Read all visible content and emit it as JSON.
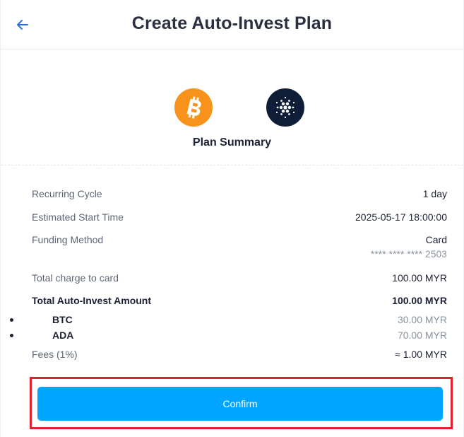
{
  "header": {
    "title": "Create Auto-Invest Plan",
    "back_icon": "arrow-left-icon"
  },
  "summary": {
    "title": "Plan Summary",
    "coins": [
      {
        "symbol": "BTC",
        "icon": "bitcoin-icon",
        "color": "#f7931a"
      },
      {
        "symbol": "ADA",
        "icon": "cardano-icon",
        "color": "#0f1e36"
      }
    ]
  },
  "details": {
    "recurring_cycle": {
      "label": "Recurring Cycle",
      "value": "1 day"
    },
    "start_time": {
      "label": "Estimated Start Time",
      "value": "2025-05-17 18:00:00"
    },
    "funding_method": {
      "label": "Funding Method",
      "value": "Card",
      "card_number": "**** **** **** 2503"
    },
    "total_charge": {
      "label": "Total charge to card",
      "value": "100.00 MYR"
    },
    "total_amount": {
      "label": "Total Auto-Invest Amount",
      "value": "100.00 MYR"
    },
    "assets": [
      {
        "symbol": "BTC",
        "amount": "30.00 MYR"
      },
      {
        "symbol": "ADA",
        "amount": "70.00 MYR"
      }
    ],
    "fees": {
      "label": "Fees (1%)",
      "value": "≈ 1.00 MYR"
    }
  },
  "confirm": {
    "label": "Confirm"
  },
  "colors": {
    "accent": "#00a6ff",
    "highlight": "#e0222e",
    "back_arrow": "#2f6fe0"
  }
}
